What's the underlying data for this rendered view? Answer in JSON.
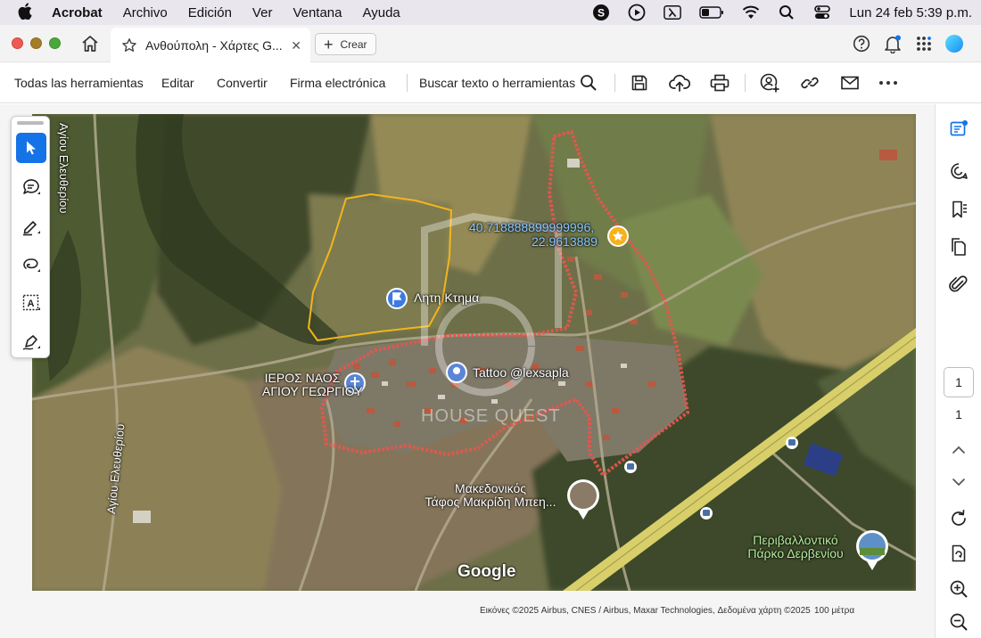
{
  "menubar": {
    "app_name": "Acrobat",
    "items": [
      "Archivo",
      "Edición",
      "Ver",
      "Ventana",
      "Ayuda"
    ],
    "clock": "Lun 24 feb  5:39 p.m.",
    "tray_icons": [
      "skype-icon",
      "play-circle-icon",
      "lambda-icon",
      "battery-icon",
      "wifi-icon",
      "search-icon",
      "control-center-icon"
    ]
  },
  "tabbar": {
    "tab_title": "Ανθούπολη - Χάρτες G...",
    "close_glyph": "✕",
    "create_label": "Crear",
    "right_icons": [
      "help-icon",
      "notifications-bell-icon",
      "apps-grid-icon",
      "profile-avatar-icon"
    ]
  },
  "toolbar": {
    "all_tools": "Todas las herramientas",
    "edit": "Editar",
    "convert": "Convertir",
    "esign": "Firma electrónica",
    "search": "Buscar texto o herramientas",
    "icons": [
      "search-icon",
      "save-icon",
      "upload-cloud-icon",
      "print-icon",
      "share-user-icon",
      "link-icon",
      "mail-icon",
      "more-icon"
    ]
  },
  "tool_palette": {
    "tools": [
      "select-arrow-icon",
      "comment-add-icon",
      "highlight-pen-icon",
      "freehand-lasso-icon",
      "text-select-icon",
      "sign-pen-icon"
    ],
    "active_index": 0
  },
  "map": {
    "labels": {
      "road_top": "Αγίου Ελευθερίου",
      "road_bottom": "Αγίου Ελευθερίου",
      "coord_line1": "40.718888899999996,",
      "coord_line2": "22.9613889",
      "plot": "Λητη Κτημα",
      "church_line1": "ΙΕΡΟΣ ΝΑΟΣ",
      "church_line2": "ΑΓΙΟΥ ΓΕΩΡΓΙΟΥ",
      "tattoo": "Tattoo @lexsapla",
      "watermark": "HOUSE QUEST",
      "tomb_line1": "Μακεδονικός",
      "tomb_line2": "Τάφος Μακρίδη Μπεη...",
      "park_line1": "Περιβαλλοντικό",
      "park_line2": "Πάρκο Δερβενίου",
      "google": "Google"
    },
    "attribution": "Εικόνες ©2025 Airbus, CNES / Airbus, Maxar Technologies, Δεδομένα χάρτη ©2025",
    "scale": "100 μέτρα",
    "colors": {
      "boundary": "#e0574f",
      "plot_outline": "#f2b51c",
      "highway": "#d8cf6a",
      "pin_blue": "#3d7be0",
      "star_pin": "#f6b21b"
    }
  },
  "right_rail": {
    "icons": [
      "comment-panel-icon",
      "ai-assistant-icon",
      "bookmarks-icon",
      "pages-icon",
      "attachment-icon",
      "chevron-up-icon",
      "chevron-down-icon",
      "refresh-icon",
      "page-export-icon",
      "zoom-in-icon",
      "zoom-out-icon"
    ],
    "current_page": "1",
    "total_pages": "1"
  }
}
